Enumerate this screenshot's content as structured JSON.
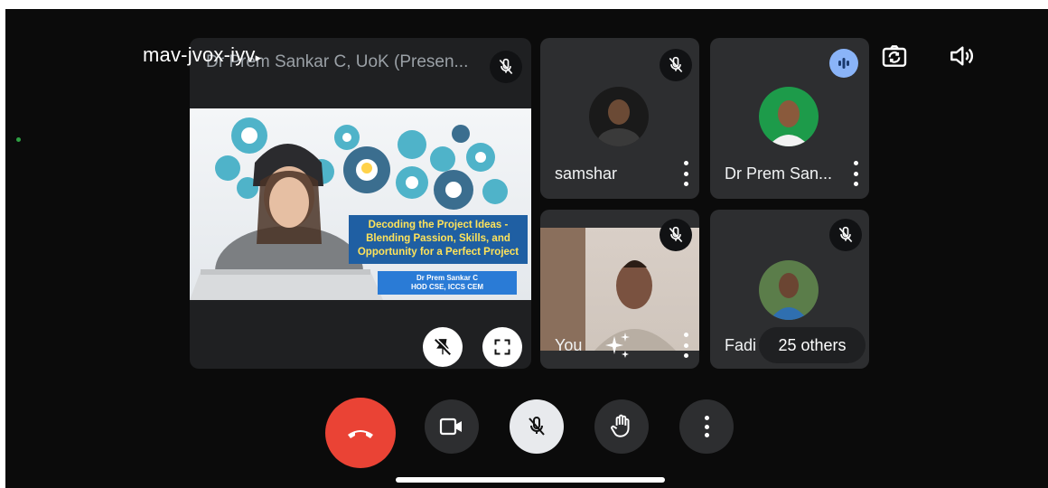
{
  "meeting": {
    "code": "mav-jvox-iyv"
  },
  "presenter_tile": {
    "title": "Dr Prem Sankar C, UoK (Presen...",
    "slide": {
      "headline": "Decoding the Project Ideas - Blending Passion, Skills, and Opportunity for a Perfect Project",
      "author_name": "Dr Prem Sankar C",
      "author_role": "HOD CSE, ICCS CEM"
    }
  },
  "participants": [
    {
      "name": "samshar",
      "mic": "muted"
    },
    {
      "name": "Dr Prem San...",
      "mic": "speaking"
    },
    {
      "name": "You",
      "mic": "muted"
    },
    {
      "name": "Fadi",
      "mic": "muted"
    }
  ],
  "overflow": {
    "label": "25 others"
  },
  "top_icons": [
    "camera-switch-icon",
    "speaker-icon"
  ],
  "controls": [
    "end-call",
    "camera",
    "microphone",
    "raise-hand",
    "more-options"
  ],
  "colors": {
    "end_call": "#ea4335",
    "speaking": "#8ab4f8",
    "tile": "#2d2e30",
    "background": "#0b0b0b"
  }
}
